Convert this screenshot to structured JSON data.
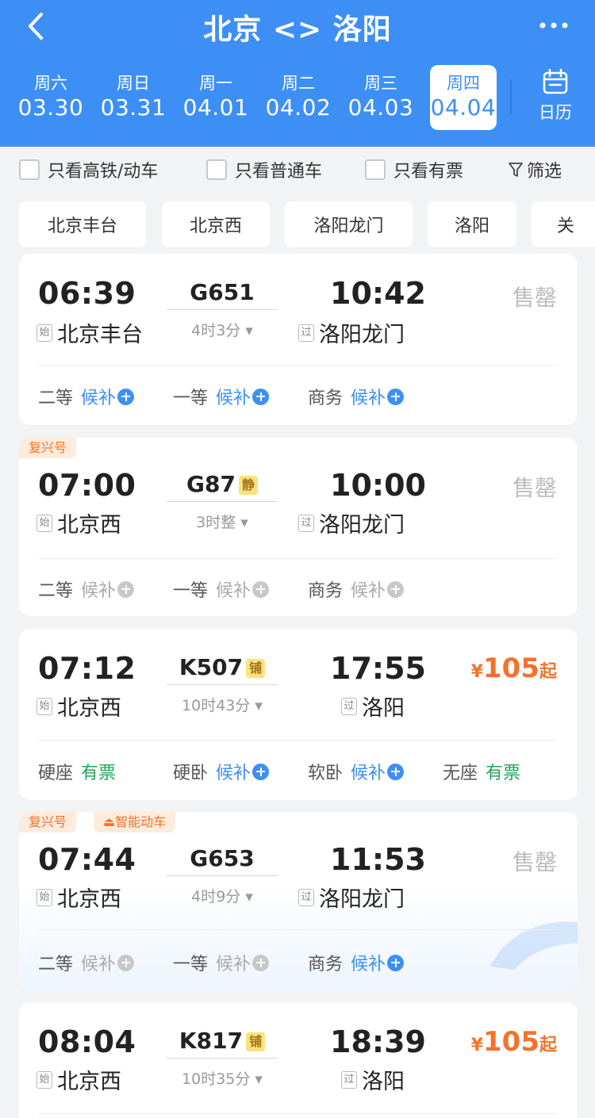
{
  "header": {
    "title": "北京 <> 洛阳",
    "calendar_label": "日历",
    "dates": [
      {
        "weekday": "周六",
        "date": "03.30",
        "selected": false
      },
      {
        "weekday": "周日",
        "date": "03.31",
        "selected": false
      },
      {
        "weekday": "周一",
        "date": "04.01",
        "selected": false
      },
      {
        "weekday": "周二",
        "date": "04.02",
        "selected": false
      },
      {
        "weekday": "周三",
        "date": "04.03",
        "selected": false
      },
      {
        "weekday": "周四",
        "date": "04.04",
        "selected": true
      }
    ]
  },
  "filters": {
    "high_speed": "只看高铁/动车",
    "normal": "只看普通车",
    "available": "只看有票",
    "filter_label": "筛选"
  },
  "stations": [
    "北京丰台",
    "北京西",
    "洛阳龙门",
    "洛阳",
    "关"
  ],
  "trains": [
    {
      "tags": [],
      "dep_time": "06:39",
      "dep_mark": "始",
      "dep_station": "北京丰台",
      "train_no": "G651",
      "badge": "",
      "duration": "4时3分",
      "arr_time": "10:42",
      "arr_mark": "过",
      "arr_station": "洛阳龙门",
      "status": "售罄",
      "price_yen": "",
      "price": "",
      "price_suffix": "",
      "seats": [
        {
          "class": "二等",
          "status": "候补",
          "type": "blue"
        },
        {
          "class": "一等",
          "status": "候补",
          "type": "blue"
        },
        {
          "class": "商务",
          "status": "候补",
          "type": "blue"
        }
      ]
    },
    {
      "tags": [
        "复兴号"
      ],
      "dep_time": "07:00",
      "dep_mark": "始",
      "dep_station": "北京西",
      "train_no": "G87",
      "badge": "静",
      "duration": "3时整",
      "arr_time": "10:00",
      "arr_mark": "过",
      "arr_station": "洛阳龙门",
      "status": "售罄",
      "price_yen": "",
      "price": "",
      "price_suffix": "",
      "seats": [
        {
          "class": "二等",
          "status": "候补",
          "type": "gray"
        },
        {
          "class": "一等",
          "status": "候补",
          "type": "gray"
        },
        {
          "class": "商务",
          "status": "候补",
          "type": "gray"
        }
      ]
    },
    {
      "tags": [],
      "dep_time": "07:12",
      "dep_mark": "始",
      "dep_station": "北京西",
      "train_no": "K507",
      "badge": "铺",
      "duration": "10时43分",
      "arr_time": "17:55",
      "arr_mark": "过",
      "arr_station": "洛阳",
      "status": "",
      "price_yen": "¥",
      "price": "105",
      "price_suffix": "起",
      "seats": [
        {
          "class": "硬座",
          "status": "有票",
          "type": "green"
        },
        {
          "class": "硬卧",
          "status": "候补",
          "type": "blue"
        },
        {
          "class": "软卧",
          "status": "候补",
          "type": "blue"
        },
        {
          "class": "无座",
          "status": "有票",
          "type": "green"
        }
      ]
    },
    {
      "tags": [
        "复兴号",
        "智能动车"
      ],
      "dep_time": "07:44",
      "dep_mark": "始",
      "dep_station": "北京西",
      "train_no": "G653",
      "badge": "",
      "duration": "4时9分",
      "arr_time": "11:53",
      "arr_mark": "过",
      "arr_station": "洛阳龙门",
      "status": "售罄",
      "price_yen": "",
      "price": "",
      "price_suffix": "",
      "seats": [
        {
          "class": "二等",
          "status": "候补",
          "type": "gray"
        },
        {
          "class": "一等",
          "status": "候补",
          "type": "gray"
        },
        {
          "class": "商务",
          "status": "候补",
          "type": "blue"
        }
      ]
    },
    {
      "tags": [],
      "dep_time": "08:04",
      "dep_mark": "始",
      "dep_station": "北京西",
      "train_no": "K817",
      "badge": "铺",
      "duration": "10时35分",
      "arr_time": "18:39",
      "arr_mark": "过",
      "arr_station": "洛阳",
      "status": "",
      "price_yen": "¥",
      "price": "105",
      "price_suffix": "起",
      "seats": []
    }
  ],
  "colors": {
    "header_blue": "#3d8ff5",
    "price_orange": "#f2732e",
    "available_green": "#21a557",
    "soldout_gray": "#bbbbbb"
  }
}
